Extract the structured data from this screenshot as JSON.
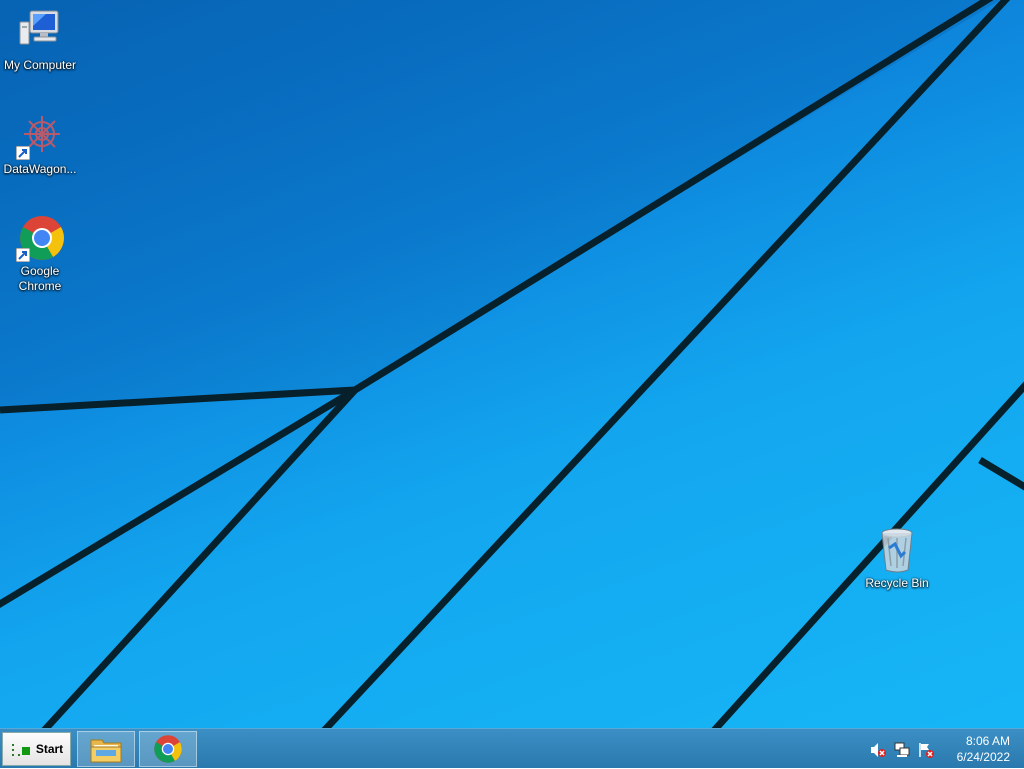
{
  "desktop": {
    "icons": [
      {
        "label": "My Computer",
        "icon": "computer-icon"
      },
      {
        "label": "DataWagon...",
        "icon": "datawagon-icon"
      },
      {
        "label": "Google Chrome",
        "icon": "chrome-icon"
      },
      {
        "label": "Recycle Bin",
        "icon": "recycle-bin-icon"
      }
    ]
  },
  "taskbar": {
    "start_label": "Start",
    "pinned": [
      {
        "name": "File Explorer",
        "icon": "folder-icon"
      },
      {
        "name": "Google Chrome",
        "icon": "chrome-icon"
      }
    ],
    "tray": {
      "icons": [
        "speaker-muted-icon",
        "network-icon",
        "action-center-flag-icon"
      ],
      "time": "8:06 AM",
      "date": "6/24/2022"
    }
  },
  "colors": {
    "taskbar": "#2f82b8",
    "desktop_accent": "#13a6ef"
  }
}
